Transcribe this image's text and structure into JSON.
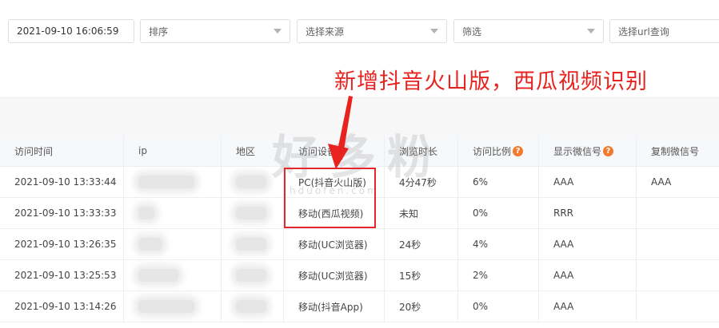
{
  "filters": {
    "date_value": "2021-09-10 16:06:59",
    "sort_placeholder": "排序",
    "source_placeholder": "选择来源",
    "filter_placeholder": "筛选",
    "url_placeholder": "选择url查询"
  },
  "annotation": "新增抖音火山版，西瓜视频识别",
  "watermark": {
    "main": "好多粉",
    "sub": "hduofen.com"
  },
  "table": {
    "headers": [
      "访问时间",
      "ip",
      "地区",
      "访问设备",
      "浏览时长",
      "访问比例",
      "显示微信号",
      "复制微信号"
    ],
    "help_icon": "?",
    "rows": [
      [
        "2021-09-10 13:33:44",
        "",
        "",
        "PC(抖音火山版)",
        "4分47秒",
        "6%",
        "AAA",
        "AAA"
      ],
      [
        "2021-09-10 13:33:33",
        "",
        "",
        "移动(西瓜视频)",
        "未知",
        "0%",
        "RRR",
        ""
      ],
      [
        "2021-09-10 13:26:35",
        "",
        "",
        "移动(UC浏览器)",
        "24秒",
        "4%",
        "AAA",
        ""
      ],
      [
        "2021-09-10 13:25:53",
        "",
        "",
        "移动(UC浏览器)",
        "15秒",
        "2%",
        "AAA",
        ""
      ],
      [
        "2021-09-10 13:14:26",
        "",
        "",
        "移动(抖音App)",
        "20秒",
        "0%",
        "AAA",
        ""
      ]
    ]
  },
  "colors": {
    "annotation": "#e8231f",
    "help_icon": "#f07a2a",
    "highlight_box": "#e3272b"
  }
}
